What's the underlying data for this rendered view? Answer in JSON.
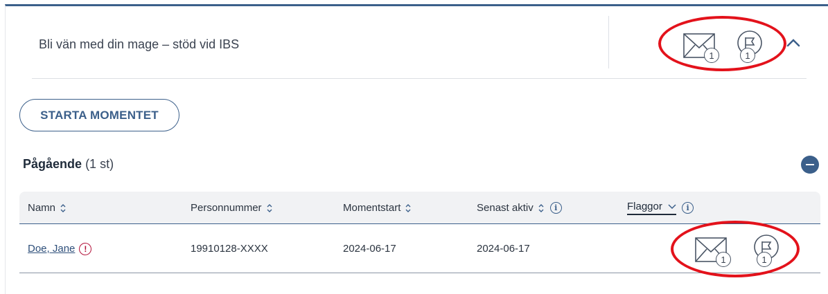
{
  "card": {
    "title": "Bli vän med din mage – stöd vid IBS",
    "messages_badge": "1",
    "flags_badge": "1",
    "start_button": "STARTA MOMENTET"
  },
  "section": {
    "title": "Pågående",
    "count": "(1 st)"
  },
  "table": {
    "headers": {
      "name": "Namn",
      "personnummer": "Personnummer",
      "momentstart": "Momentstart",
      "senast_aktiv": "Senast aktiv",
      "flaggor": "Flaggor"
    },
    "rows": [
      {
        "name": "Doe, Jane",
        "warning": "!",
        "personnummer": "19910128-XXXX",
        "momentstart": "2024-06-17",
        "senast_aktiv": "2024-06-17",
        "messages_badge": "1",
        "flags_badge": "1"
      }
    ]
  },
  "icons": {
    "messages": "envelope-icon",
    "flags": "flag-circle-icon",
    "sort": "sort-updown-icon",
    "info": "info-icon",
    "collapse": "chevron-up-icon",
    "section_toggle": "minus-circle-icon",
    "warning": "exclamation-circle-icon"
  },
  "colors": {
    "brand": "#3b5f8a",
    "annotation": "#e3121b",
    "warning": "#b3123a",
    "header_bg": "#f1f2f4"
  }
}
